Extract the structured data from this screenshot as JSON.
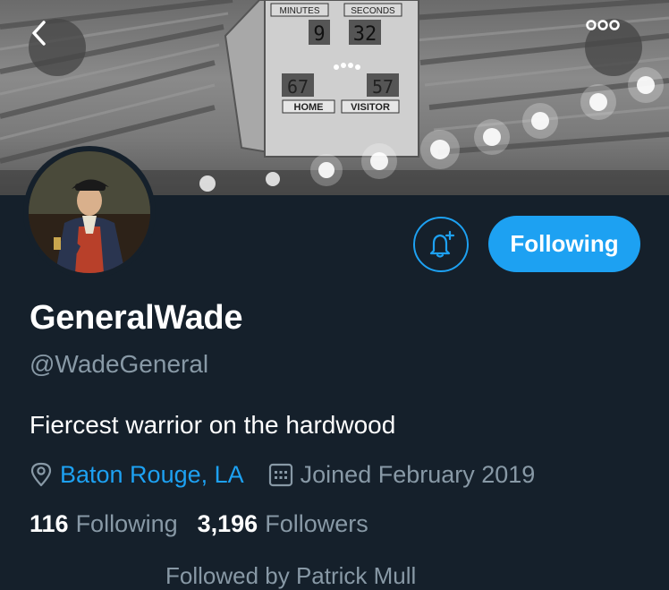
{
  "header": {
    "back_icon": "chevron-left-icon",
    "more_icon": "more-horizontal-icon",
    "banner": {
      "scoreboard_minutes_label": "MINUTES",
      "scoreboard_seconds_label": "SECONDS",
      "scoreboard_minutes_value": "9",
      "scoreboard_seconds_value": "32",
      "scoreboard_home_label": "HOME",
      "scoreboard_visitor_label": "VISITOR",
      "scoreboard_home_score": "67",
      "scoreboard_visitor_score": "57"
    }
  },
  "profile": {
    "display_name": "GeneralWade",
    "handle": "@WadeGeneral",
    "bio": "Fiercest warrior on the hardwood",
    "location": "Baton Rouge, LA",
    "joined": "Joined February 2019",
    "following_count": "116",
    "following_label": "Following",
    "followers_count": "3,196",
    "followers_label": "Followers",
    "followed_by": "Followed by Patrick Mull"
  },
  "actions": {
    "notify_icon": "bell-plus-icon",
    "following_button_label": "Following"
  },
  "colors": {
    "background": "#15202b",
    "accent": "#1da1f2",
    "secondary_text": "#8899a6",
    "primary_text": "#ffffff"
  }
}
